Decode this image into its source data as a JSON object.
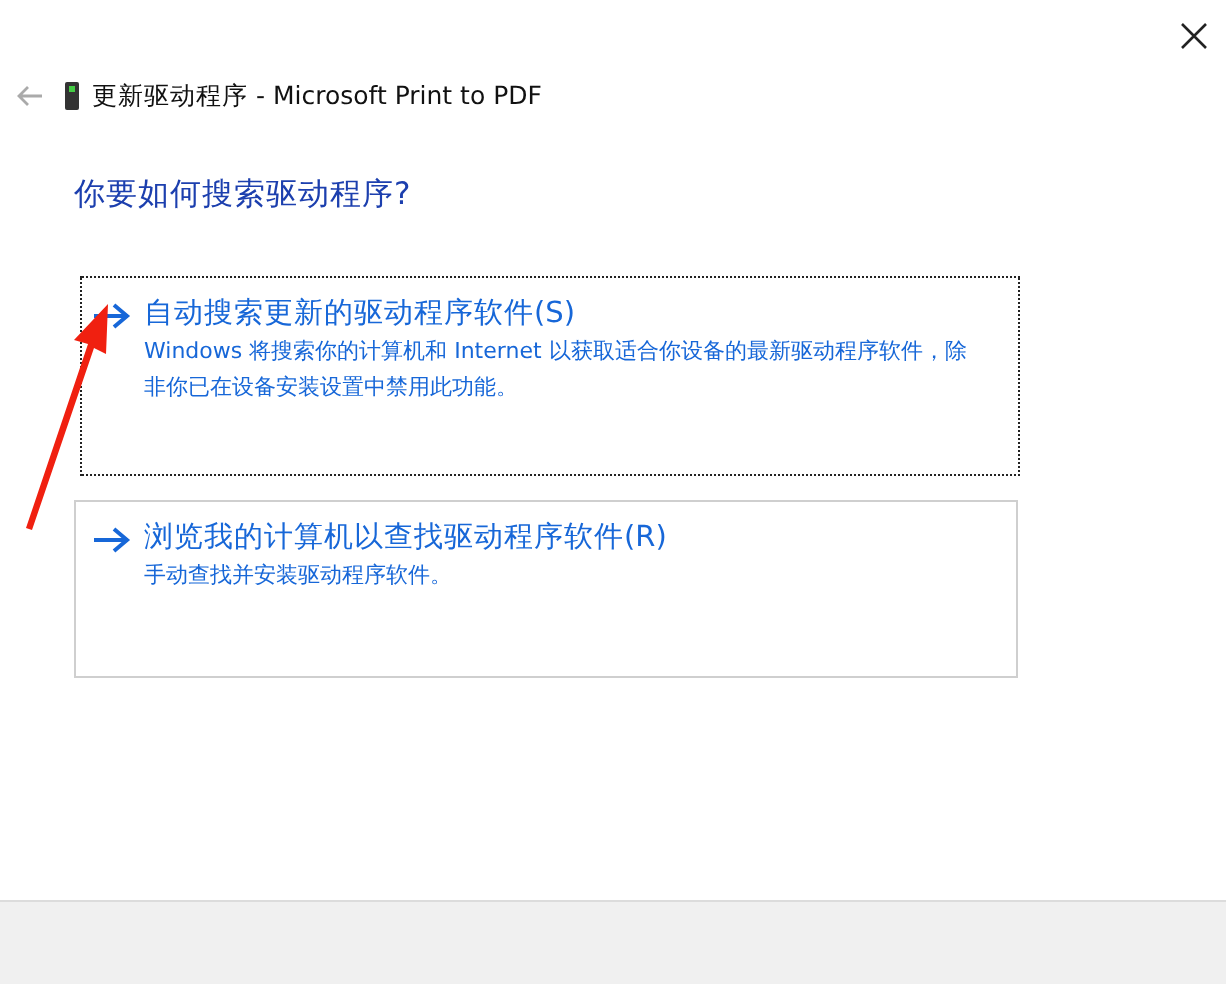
{
  "window": {
    "title": "更新驱动程序 - Microsoft Print to PDF"
  },
  "heading": "你要如何搜索驱动程序?",
  "options": [
    {
      "title": "自动搜索更新的驱动程序软件(S)",
      "description": "Windows 将搜索你的计算机和 Internet 以获取适合你设备的最新驱动程序软件，除非你已在设备安装设置中禁用此功能。",
      "focused": true
    },
    {
      "title": "浏览我的计算机以查找驱动程序软件(R)",
      "description": "手动查找并安装驱动程序软件。",
      "focused": false
    }
  ]
}
